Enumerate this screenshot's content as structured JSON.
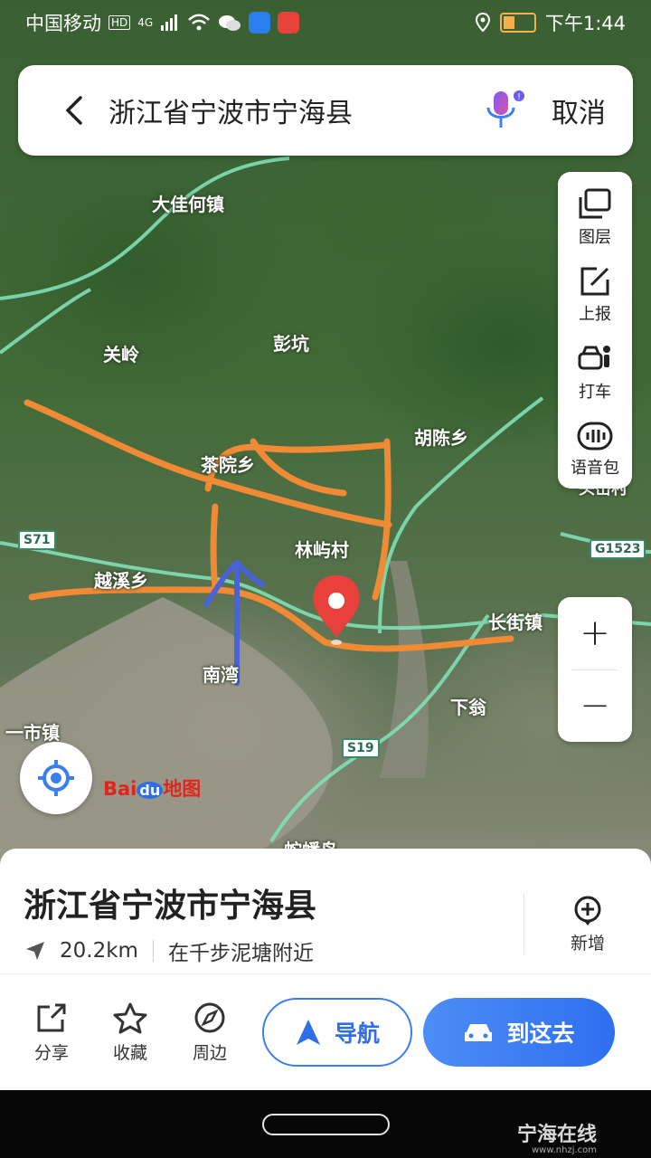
{
  "status_bar": {
    "carrier": "中国移动",
    "hd": "HD",
    "network": "4G",
    "time": "下午1:44",
    "battery": "11"
  },
  "search": {
    "query": "浙江省宁波市宁海县",
    "cancel_label": "取消"
  },
  "tools": [
    {
      "label": "图层",
      "icon": "layers-icon"
    },
    {
      "label": "上报",
      "icon": "report-icon"
    },
    {
      "label": "打车",
      "icon": "taxi-icon"
    },
    {
      "label": "语音包",
      "icon": "voice-pack-icon"
    }
  ],
  "zoom": {
    "in": "+",
    "out": "−"
  },
  "map": {
    "labels": {
      "dajiahe": "大佳何镇",
      "guanling": "关岭",
      "pengkeng": "彭坑",
      "huchen": "胡陈乡",
      "chaxi": "茶院乡",
      "linyu": "林屿村",
      "yuexi": "越溪乡",
      "nan": "南湾",
      "changjie": "长街镇",
      "xiaweng": "下翁",
      "yishi": "一市镇",
      "shepan": "蛇蟠岛",
      "right_edge": "头岙村"
    },
    "shields": {
      "s71": "S71",
      "g1523": "G1523",
      "s19": "S19"
    },
    "baidu": {
      "bai": "Bai",
      "du": "du",
      "ditu": "地图"
    }
  },
  "place": {
    "title": "浙江省宁波市宁海县",
    "distance": "20.2km",
    "nearby": "在千步泥塘附近",
    "add_label": "新增"
  },
  "actions": {
    "share": "分享",
    "favorite": "收藏",
    "nearby": "周边",
    "navigate": "导航",
    "go": "到这去"
  },
  "watermark": {
    "name": "宁海在线",
    "url": "www.nhzj.com"
  },
  "colors": {
    "accent": "#2f6ee8",
    "marker": "#e8403a",
    "annotation_orange": "#f08a34",
    "annotation_blue": "#4a62d8"
  }
}
